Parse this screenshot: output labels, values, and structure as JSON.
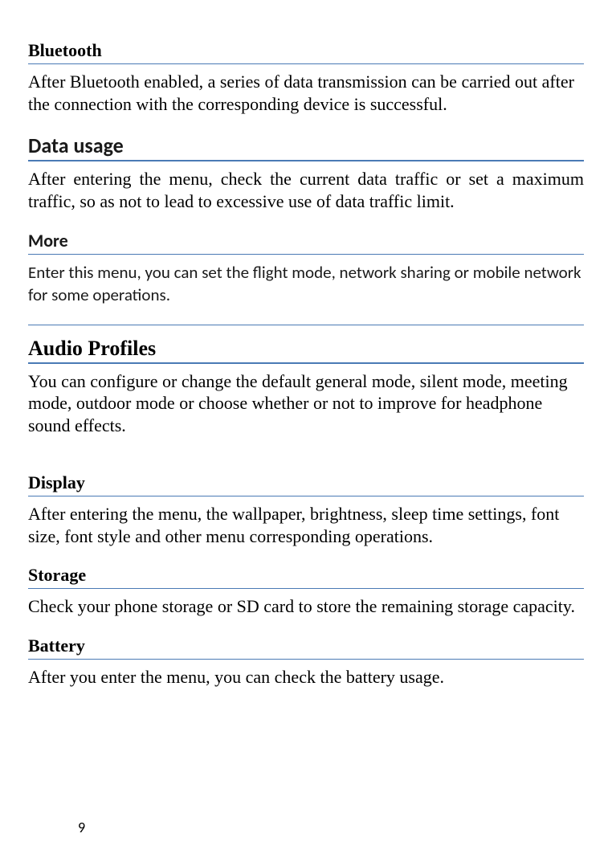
{
  "sections": {
    "bluetooth": {
      "heading": "Bluetooth",
      "body": "After Bluetooth enabled, a series of data transmission can be carried out after the connection with the corresponding device is successful."
    },
    "dataUsage": {
      "heading": "Data usage",
      "body": "After entering the menu, check the current data traffic or set a maximum traffic, so as not to lead to excessive use of data traffic limit."
    },
    "more": {
      "heading": "More",
      "body": "Enter this menu, you can set the flight mode, network sharing or mobile network for some operations."
    },
    "audioProfiles": {
      "heading": "Audio Profiles",
      "body": "You can configure or change the default general mode, silent mode, meeting mode, outdoor mode or choose whether or not to improve for headphone sound effects."
    },
    "display": {
      "heading": "Display",
      "body": "After entering the menu, the wallpaper, brightness, sleep time settings, font size, font style and other menu corresponding operations."
    },
    "storage": {
      "heading": "Storage",
      "body": "Check your phone storage or SD card to store the remaining storage capacity."
    },
    "battery": {
      "heading": "Battery",
      "body": "After you enter the menu, you can check the battery usage."
    }
  },
  "pageNumber": "9"
}
